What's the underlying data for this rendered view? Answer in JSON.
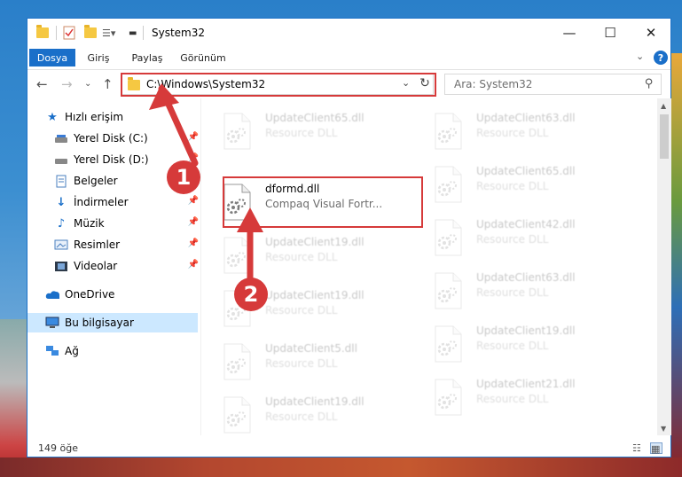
{
  "window": {
    "title": "System32",
    "accent": "#1a6fc9",
    "minimize": "—",
    "maximize": "☐",
    "close": "✕"
  },
  "ribbon": {
    "tabs": [
      {
        "label": "Dosya"
      },
      {
        "label": "Giriş"
      },
      {
        "label": "Paylaş"
      },
      {
        "label": "Görünüm"
      }
    ],
    "help": "?"
  },
  "address": {
    "path": "C:\\Windows\\System32",
    "search_placeholder": "Ara: System32"
  },
  "sidebar": {
    "items": [
      {
        "label": "Hızlı erişim",
        "icon": "star-icon",
        "pinned": false
      },
      {
        "label": "Yerel Disk (C:)",
        "icon": "drive-icon",
        "pinned": true
      },
      {
        "label": "Yerel Disk (D:)",
        "icon": "drive-icon",
        "pinned": true
      },
      {
        "label": "Belgeler",
        "icon": "documents-icon",
        "pinned": true
      },
      {
        "label": "İndirmeler",
        "icon": "download-icon",
        "pinned": true
      },
      {
        "label": "Müzik",
        "icon": "music-icon",
        "pinned": true
      },
      {
        "label": "Resimler",
        "icon": "pictures-icon",
        "pinned": true
      },
      {
        "label": "Videolar",
        "icon": "video-icon",
        "pinned": true
      },
      {
        "label": "OneDrive",
        "icon": "cloud-icon",
        "pinned": false
      },
      {
        "label": "Bu bilgisayar",
        "icon": "computer-icon",
        "pinned": false,
        "selected": true
      },
      {
        "label": "Ağ",
        "icon": "network-icon",
        "pinned": false
      }
    ]
  },
  "files": {
    "left": [
      {
        "name": "UpdateClient65.dll",
        "desc": "Resource DLL",
        "faded": true
      },
      {
        "name": "dformd.dll",
        "desc": "Compaq Visual Fortr...",
        "faded": false,
        "highlighted": true
      },
      {
        "name": "UpdateClient19.dll",
        "desc": "Resource DLL",
        "faded": true
      },
      {
        "name": "UpdateClient19.dll",
        "desc": "Resource DLL",
        "faded": true
      },
      {
        "name": "UpdateClient5.dll",
        "desc": "Resource DLL",
        "faded": true
      },
      {
        "name": "UpdateClient19.dll",
        "desc": "Resource DLL",
        "faded": true
      }
    ],
    "right": [
      {
        "name": "UpdateClient63.dll",
        "desc": "Resource DLL",
        "faded": true
      },
      {
        "name": "UpdateClient65.dll",
        "desc": "Resource DLL",
        "faded": true
      },
      {
        "name": "UpdateClient42.dll",
        "desc": "Resource DLL",
        "faded": true
      },
      {
        "name": "UpdateClient63.dll",
        "desc": "Resource DLL",
        "faded": true
      },
      {
        "name": "UpdateClient19.dll",
        "desc": "Resource DLL",
        "faded": true
      },
      {
        "name": "UpdateClient21.dll",
        "desc": "Resource DLL",
        "faded": true
      }
    ]
  },
  "status": {
    "count": "149 öğe"
  },
  "annotations": {
    "badge1": "1",
    "badge2": "2",
    "color": "#d63a3a"
  }
}
